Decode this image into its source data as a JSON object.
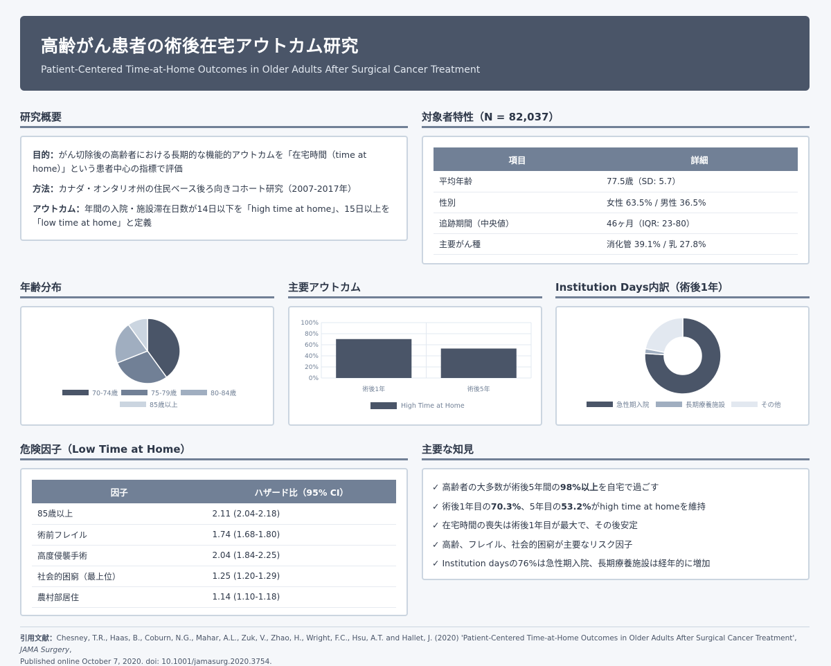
{
  "header": {
    "title": "高齢がん患者の術後在宅アウトカム研究",
    "subtitle": "Patient-Centered Time-at-Home Outcomes in Older Adults After Surgical Cancer Treatment"
  },
  "overview": {
    "title": "研究概要",
    "purpose_label": "目的：",
    "purpose_text": "がん切除後の高齢者における長期的な機能的アウトカムを「在宅時間（time at home）」という患者中心の指標で評価",
    "method_label": "方法：",
    "method_text": "カナダ・オンタリオ州の住民ベース後ろ向きコホート研究（2007-2017年）",
    "outcome_label": "アウトカム：",
    "outcome_text": "年間の入院・施設滞在日数が14日以下を「high time at home」、15日以上を「low time at home」と定義"
  },
  "characteristics": {
    "title": "対象者特性（N = 82,037）",
    "headers": [
      "項目",
      "詳細"
    ],
    "rows": [
      [
        "平均年齢",
        "77.5歳（SD: 5.7）"
      ],
      [
        "性別",
        "女性 63.5% / 男性 36.5%"
      ],
      [
        "追跡期間（中央値）",
        "46ヶ月（IQR: 23-80）"
      ],
      [
        "主要がん種",
        "消化管 39.1% / 乳 27.8%"
      ]
    ]
  },
  "age_section": {
    "title": "年齢分布"
  },
  "outcome_section": {
    "title": "主要アウトカム"
  },
  "institution_section": {
    "title": "Institution Days内訳（術後1年）"
  },
  "risk": {
    "title": "危険因子（Low Time at Home）",
    "headers": [
      "因子",
      "ハザード比（95% CI）"
    ],
    "rows": [
      [
        "85歳以上",
        "2.11 (2.04-2.18)"
      ],
      [
        "術前フレイル",
        "1.74 (1.68-1.80)"
      ],
      [
        "高度侵襲手術",
        "2.04 (1.84-2.25)"
      ],
      [
        "社会的困窮（最上位）",
        "1.25 (1.20-1.29)"
      ],
      [
        "農村部居住",
        "1.14 (1.10-1.18)"
      ]
    ]
  },
  "findings": {
    "title": "主要な知見",
    "items": [
      {
        "pre": "✓ 高齢者の大多数が術後5年間の",
        "bold": "98%以上",
        "post": "を自宅で過ごす",
        "bold2": "",
        "post2": ""
      },
      {
        "pre": "✓ 術後1年目の",
        "bold": "70.3%",
        "post": "、5年目の",
        "bold2": "53.2%",
        "post2": "がhigh time at homeを維持"
      },
      {
        "pre": "✓ 在宅時間の喪失は術後1年目が最大で、その後安定",
        "bold": "",
        "post": "",
        "bold2": "",
        "post2": ""
      },
      {
        "pre": "✓ 高齢、フレイル、社会的困窮が主要なリスク因子",
        "bold": "",
        "post": "",
        "bold2": "",
        "post2": ""
      },
      {
        "pre": "✓ Institution daysの76%は急性期入院、長期療養施設は経年的に増加",
        "bold": "",
        "post": "",
        "bold2": "",
        "post2": ""
      }
    ]
  },
  "citation": {
    "label": "引用文献：",
    "text1": "Chesney, T.R., Haas, B., Coburn, N.G., Mahar, A.L., Zuk, V., Zhao, H., Wright, F.C., Hsu, A.T. and Hallet, J. (2020) 'Patient-Centered Time-at-Home Outcomes in Older Adults After Surgical Cancer Treatment', ",
    "journal": "JAMA Surgery",
    "text2": ",",
    "line2": "Published online October 7, 2020. doi: 10.1001/jamasurg.2020.3754."
  },
  "chart_data": [
    {
      "type": "pie",
      "categories": [
        "70-74歳",
        "75-79歳",
        "80-84歳",
        "85歳以上"
      ],
      "values": [
        40,
        29,
        21,
        10
      ],
      "colors": [
        "#4a5568",
        "#718096",
        "#a0aec0",
        "#cbd5e0"
      ]
    },
    {
      "type": "bar",
      "categories": [
        "術後1年",
        "術後5年"
      ],
      "series": [
        {
          "name": "High Time at Home",
          "values": [
            70.3,
            53.2
          ]
        }
      ],
      "ylim": [
        0,
        100
      ],
      "yticks": [
        "0%",
        "20%",
        "40%",
        "60%",
        "80%",
        "100%"
      ],
      "grid": true,
      "legend": "bottom",
      "colors": [
        "#4a5568"
      ]
    },
    {
      "type": "pie",
      "categories": [
        "急性期入院",
        "長期療養施設",
        "その他"
      ],
      "values": [
        76,
        2,
        22
      ],
      "colors": [
        "#4a5568",
        "#a0aec0",
        "#e2e8f0"
      ]
    }
  ]
}
